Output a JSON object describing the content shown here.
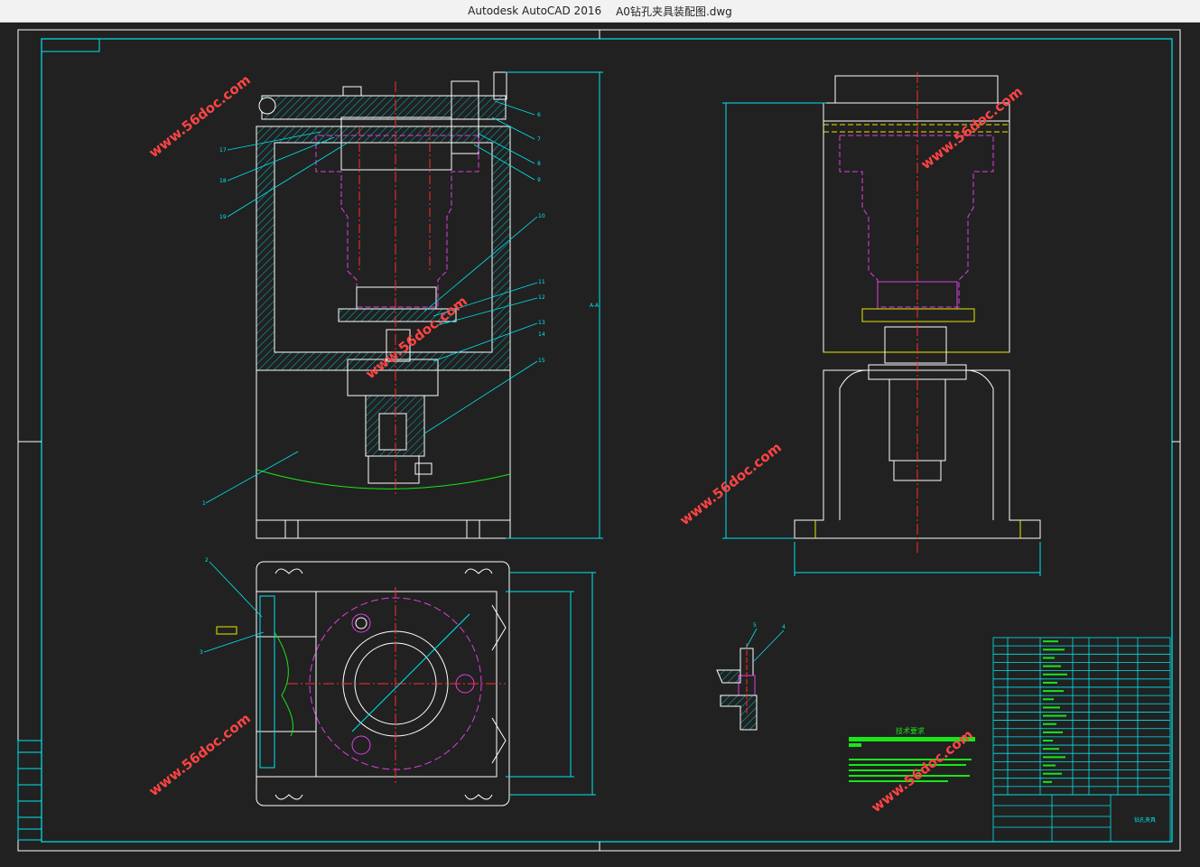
{
  "window": {
    "app_name": "Autodesk AutoCAD 2016",
    "file_name": "A0钻孔夹具装配图.dwg"
  },
  "colors": {
    "background": "#212121",
    "white": "#ffffff",
    "cyan": "#00e5ee",
    "magenta": "#e040e0",
    "red": "#ff2a2a",
    "green": "#19e619",
    "yellow": "#e8e800"
  },
  "drawing": {
    "section_label": "A-A",
    "balloons_top_right": [
      "6",
      "7",
      "8",
      "9"
    ],
    "balloons_left": [
      "17",
      "18",
      "19"
    ],
    "balloons_mid": [
      "10",
      "11",
      "12",
      "13",
      "14",
      "15"
    ],
    "balloon_base": "1",
    "balloons_plan": [
      "2",
      "3"
    ],
    "balloons_detail": [
      "5",
      "4"
    ],
    "tech_req_title": "技术要求"
  },
  "watermarks": [
    "www.56doc.com",
    "www.56doc.com",
    "www.56doc.com",
    "www.56doc.com",
    "www.56doc.com",
    "www.56doc.com"
  ],
  "title_block": {
    "drawing_name": "钻孔夹具"
  }
}
